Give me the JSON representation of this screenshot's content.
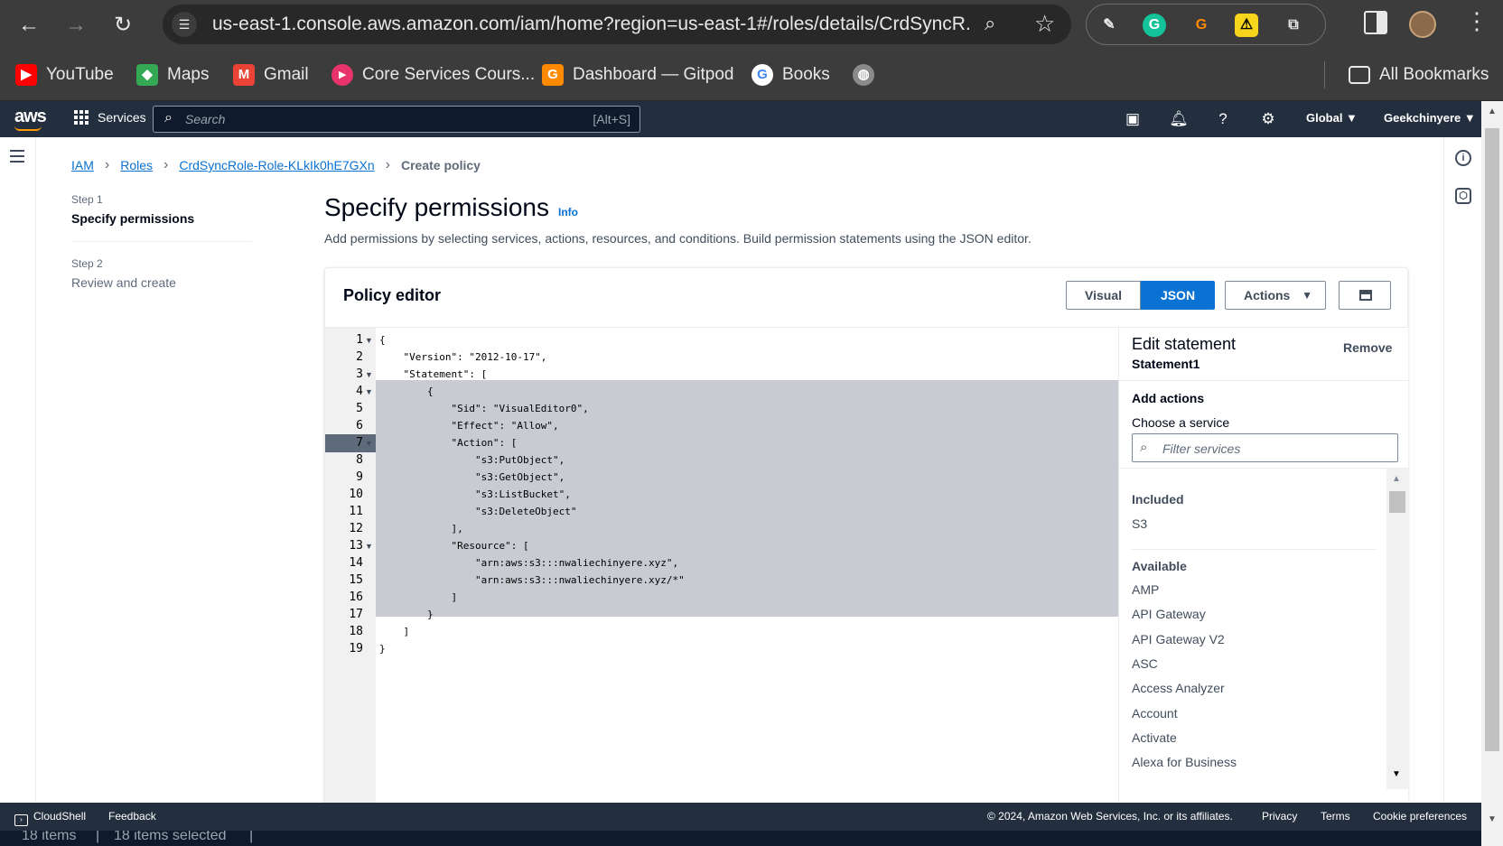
{
  "browser": {
    "url": "us-east-1.console.aws.amazon.com/iam/home?region=us-east-1#/roles/details/CrdSyncR...",
    "bookmarks": [
      {
        "label": "YouTube",
        "icon": "youtube-icon",
        "color": "#ff0000"
      },
      {
        "label": "Maps",
        "icon": "maps-icon",
        "color": "#34a853"
      },
      {
        "label": "Gmail",
        "icon": "gmail-icon",
        "color": "#ea4335"
      },
      {
        "label": "Core Services Cours...",
        "icon": "play-circle-icon",
        "color": "#e8336d"
      },
      {
        "label": "Dashboard — Gitpod",
        "icon": "gitpod-icon",
        "color": "#ff8a00"
      },
      {
        "label": "Books",
        "icon": "google-icon",
        "color": "#4285f4"
      }
    ],
    "all_bookmarks": "All Bookmarks"
  },
  "aws_nav": {
    "logo": "aws",
    "services": "Services",
    "search_placeholder": "Search",
    "search_shortcut": "[Alt+S]",
    "region": "Global ▼",
    "account": "Geekchinyere ▼"
  },
  "breadcrumb": {
    "iam": "IAM",
    "roles": "Roles",
    "role": "CrdSyncRole-Role-KLkIk0hE7GXn",
    "current": "Create policy"
  },
  "steps": [
    {
      "label": "Step 1",
      "title": "Specify permissions"
    },
    {
      "label": "Step 2",
      "title": "Review and create"
    }
  ],
  "page": {
    "title": "Specify permissions",
    "info": "Info",
    "description": "Add permissions by selecting services, actions, resources, and conditions. Build permission statements using the JSON editor."
  },
  "editor": {
    "title": "Policy editor",
    "visual": "Visual",
    "json": "JSON",
    "actions": "Actions",
    "active_line": 7,
    "lines": [
      "{",
      "    \"Version\": \"2012-10-17\",",
      "    \"Statement\": [",
      "        {",
      "            \"Sid\": \"VisualEditor0\",",
      "            \"Effect\": \"Allow\",",
      "            \"Action\": [",
      "                \"s3:PutObject\",",
      "                \"s3:GetObject\",",
      "                \"s3:ListBucket\",",
      "                \"s3:DeleteObject\"",
      "            ],",
      "            \"Resource\": [",
      "                \"arn:aws:s3:::nwaliechinyere.xyz\",",
      "                \"arn:aws:s3:::nwaliechinyere.xyz/*\"",
      "            ]",
      "        }",
      "    ]",
      "}"
    ],
    "fold_lines": [
      1,
      3,
      4,
      7,
      13
    ]
  },
  "statement_panel": {
    "title": "Edit statement",
    "name": "Statement1",
    "remove": "Remove",
    "add_actions": "Add actions",
    "choose_service": "Choose a service",
    "filter_placeholder": "Filter services",
    "included_heading": "Included",
    "included": [
      "S3"
    ],
    "available_heading": "Available",
    "available": [
      "AMP",
      "API Gateway",
      "API Gateway V2",
      "ASC",
      "Access Analyzer",
      "Account",
      "Activate",
      "Alexa for Business"
    ]
  },
  "footer": {
    "cloudshell": "CloudShell",
    "feedback": "Feedback",
    "copyright": "© 2024, Amazon Web Services, Inc. or its affiliates.",
    "privacy": "Privacy",
    "terms": "Terms",
    "cookies": "Cookie preferences"
  },
  "bleed": {
    "items": "18 items",
    "selected": "18 items selected"
  }
}
